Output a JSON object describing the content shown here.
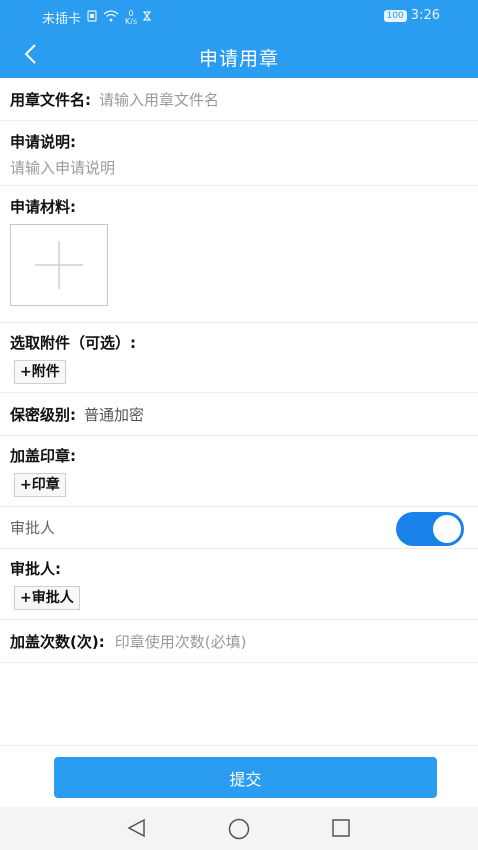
{
  "status_bar": {
    "carrier": "未插卡",
    "speed_value": "0",
    "speed_unit": "K/s",
    "battery": "100",
    "time": "3:26"
  },
  "nav": {
    "title": "申请用章"
  },
  "form": {
    "filename": {
      "label": "用章文件名:",
      "placeholder": "请输入用章文件名"
    },
    "description": {
      "label": "申请说明:",
      "placeholder": "请输入申请说明"
    },
    "materials": {
      "label": "申请材料:"
    },
    "attachment": {
      "label": "选取附件（可选）:",
      "button": "+附件"
    },
    "secrecy": {
      "label": "保密级别:",
      "value": "普通加密"
    },
    "seal": {
      "label": "加盖印章:",
      "button": "+印章"
    },
    "approver_toggle": {
      "label": "审批人",
      "enabled": true
    },
    "approver": {
      "label": "审批人:",
      "button": "+审批人"
    },
    "seal_count": {
      "label": "加盖次数(次):",
      "placeholder": "印章使用次数(必填)"
    }
  },
  "submit": {
    "label": "提交"
  },
  "colors": {
    "primary": "#2b9df0",
    "toggle_on": "#1a82e8"
  }
}
